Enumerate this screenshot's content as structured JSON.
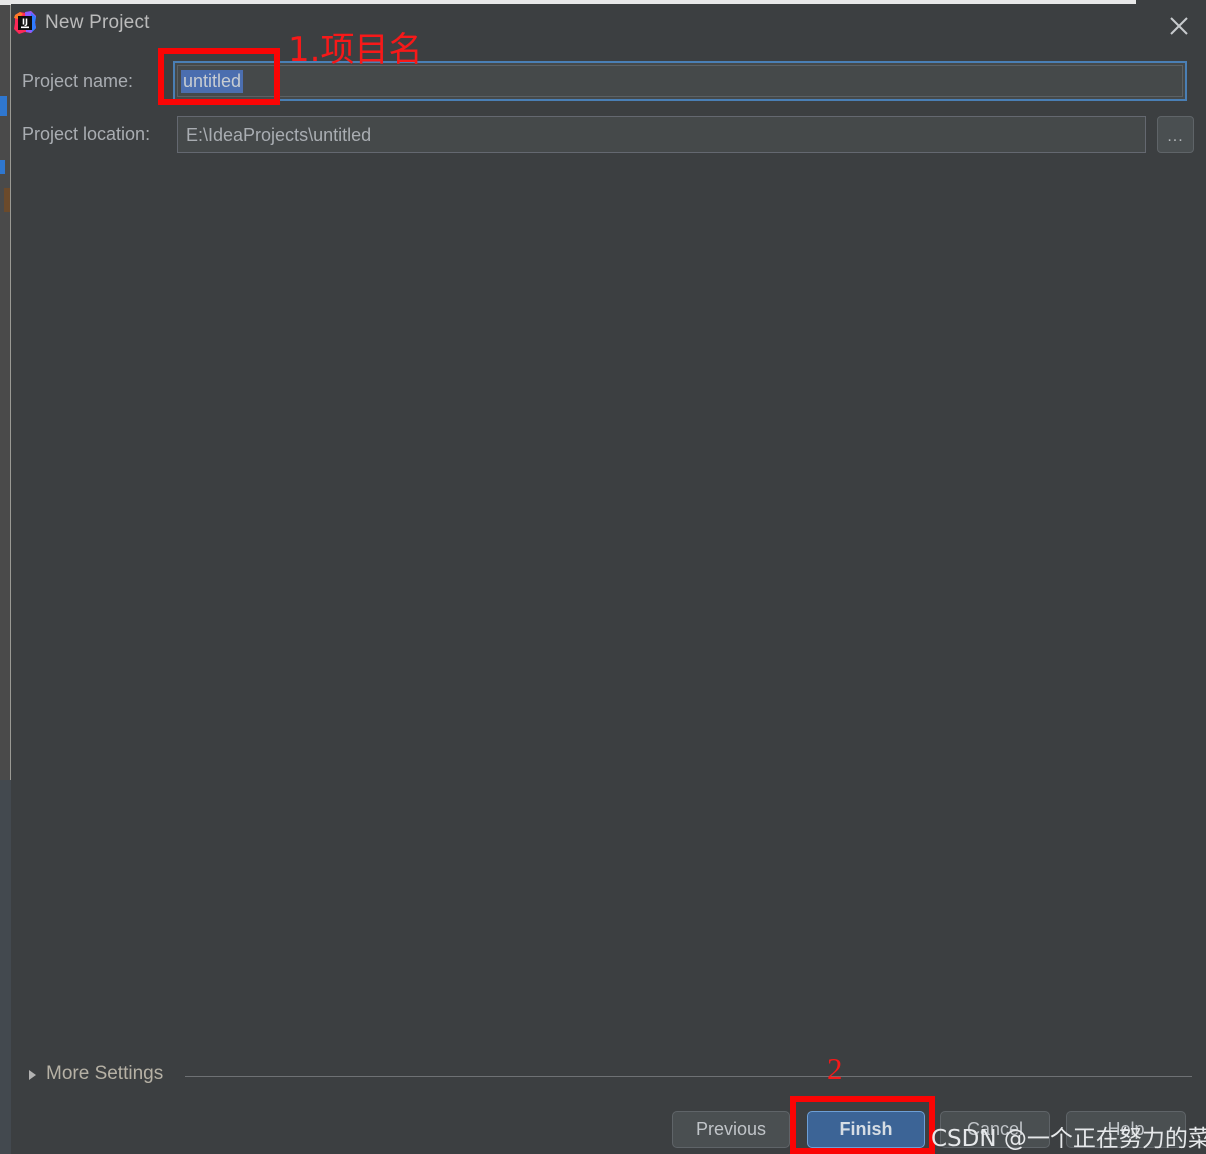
{
  "window": {
    "title": "New Project",
    "app_icon": "intellij-idea-icon",
    "close_icon": "close-icon"
  },
  "form": {
    "project_name": {
      "label": "Project name:",
      "value": "untitled",
      "placeholder": "untitled"
    },
    "project_location": {
      "label": "Project location:",
      "value": "E:\\IdeaProjects\\untitled",
      "placeholder": "E:\\IdeaProjects\\untitled",
      "browse_label": "...",
      "browse_icon": "ellipsis-icon"
    }
  },
  "more_settings": {
    "label": "More Settings",
    "expand_icon": "chevron-right-icon",
    "expanded": false
  },
  "buttons": {
    "previous": "Previous",
    "finish": "Finish",
    "cancel": "Cancel",
    "help": "Help"
  },
  "annotations": {
    "step1": "1.项目名",
    "step2": "2",
    "color": "#fb0404"
  },
  "watermark": {
    "text": "CSDN @一个正在努力的菜鸡"
  },
  "colors": {
    "dialog_background": "#3c3f41",
    "field_background": "#45494a",
    "focus_border": "#4a7fb5",
    "selection_background": "#4b6eaf",
    "primary_button": "#3c6496",
    "text": "#a9adb2",
    "annotation_red": "#fb0404"
  }
}
